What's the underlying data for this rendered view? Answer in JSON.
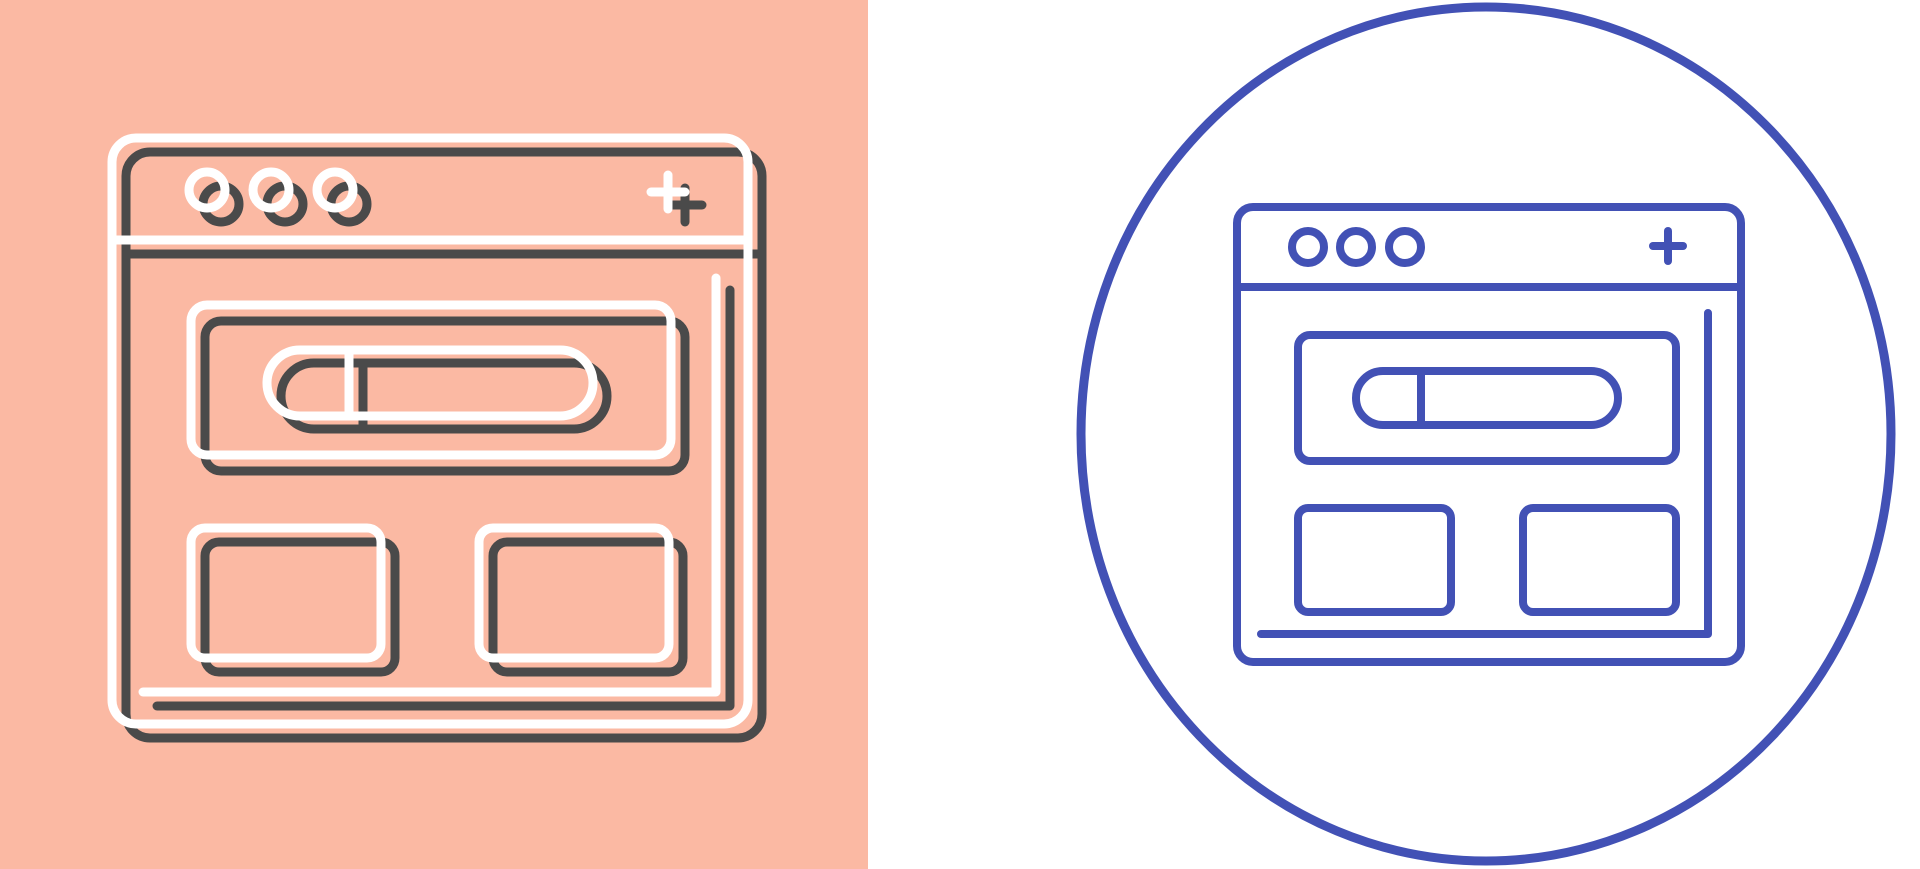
{
  "colors": {
    "left_background": "#FBB9A3",
    "left_stroke": "#FFFFFF",
    "left_shadow": "#4A4A4A",
    "right_background": "#FFFFFF",
    "right_stroke": "#4251B5",
    "circle_stroke": "#4251B5"
  },
  "icons": {
    "left": "browser-window-flat-icon",
    "right": "browser-window-line-icon",
    "window_controls": [
      "dot-icon",
      "dot-icon",
      "dot-icon"
    ],
    "new_tab": "plus-icon",
    "search_bar": "search-bar-icon",
    "content_blocks": [
      "content-block-icon",
      "content-block-icon"
    ]
  }
}
